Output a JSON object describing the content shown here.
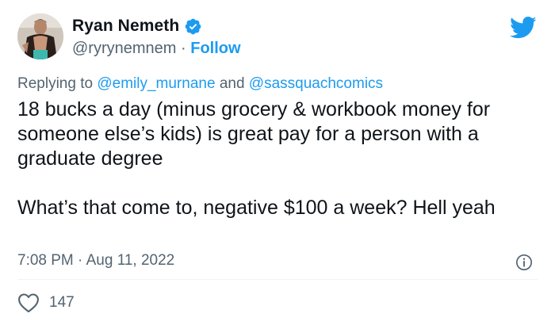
{
  "author": {
    "display_name": "Ryan Nemeth",
    "handle": "@ryrynemnem",
    "separator": "·",
    "follow_label": "Follow",
    "avatar_icon": "profile-photo",
    "verified_icon": "verified-badge-icon"
  },
  "header": {
    "logo_icon": "twitter-bird-icon"
  },
  "colors": {
    "accent": "#1d9bf0",
    "text_primary": "#0f1419",
    "text_secondary": "#536471",
    "divider": "#eff3f4"
  },
  "reply_context": {
    "prefix": "Replying to",
    "mention_1": "@emily_murnane",
    "conjunction": "and",
    "mention_2": "@sassquachcomics"
  },
  "tweet": {
    "text": "18 bucks a day (minus grocery & workbook money for someone else’s kids) is great pay for a person with a graduate degree\n\nWhat’s that come to, negative $100 a week? Hell yeah",
    "time": "7:08 PM",
    "date_separator": "·",
    "date": "Aug 11, 2022",
    "info_icon": "info-icon"
  },
  "engagement": {
    "like_icon": "heart-icon",
    "like_count": "147"
  }
}
